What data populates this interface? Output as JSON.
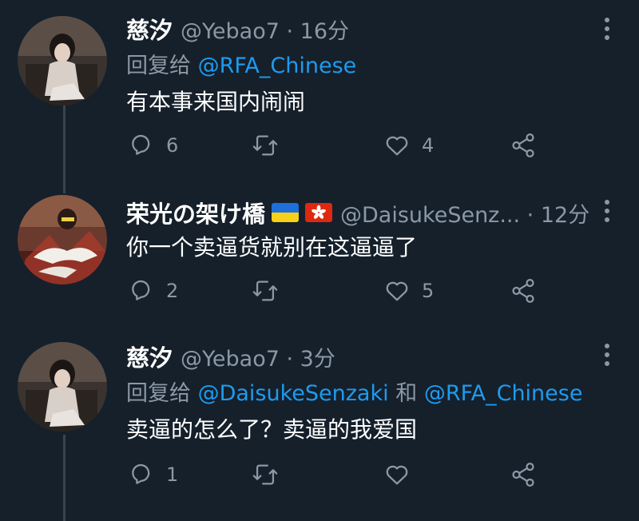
{
  "tweets": [
    {
      "display_name": "慈汐",
      "handle_meta": "@Yebao7 · 16分",
      "reply_prefix": "回复给",
      "reply_mentions": [
        "@RFA_Chinese"
      ],
      "reply_joiner": "",
      "text": "有本事来国内闹闹",
      "actions": {
        "reply_count": "6",
        "retweet_count": "",
        "like_count": "4"
      }
    },
    {
      "display_name": "荣光の架け橋",
      "flags": [
        "ukraine-flag",
        "hong-kong-flag"
      ],
      "handle_meta": "@DaisukeSenz... · 12分",
      "text": "你一个卖逼货就别在这逼逼了",
      "actions": {
        "reply_count": "2",
        "retweet_count": "",
        "like_count": "5"
      }
    },
    {
      "display_name": "慈汐",
      "handle_meta": "@Yebao7 · 3分",
      "reply_prefix": "回复给",
      "reply_mentions": [
        "@DaisukeSenzaki",
        "@RFA_Chinese"
      ],
      "reply_joiner": "和",
      "text": "卖逼的怎么了？卖逼的我爱国",
      "actions": {
        "reply_count": "1",
        "retweet_count": "",
        "like_count": ""
      }
    }
  ],
  "colors": {
    "background": "#15202b",
    "primary_text": "#ffffff",
    "secondary_text": "#8b98a5",
    "link": "#1d9bf0",
    "thread_line": "#38444d"
  },
  "icons": [
    "reply-icon",
    "retweet-icon",
    "like-icon",
    "share-icon",
    "more-icon"
  ]
}
